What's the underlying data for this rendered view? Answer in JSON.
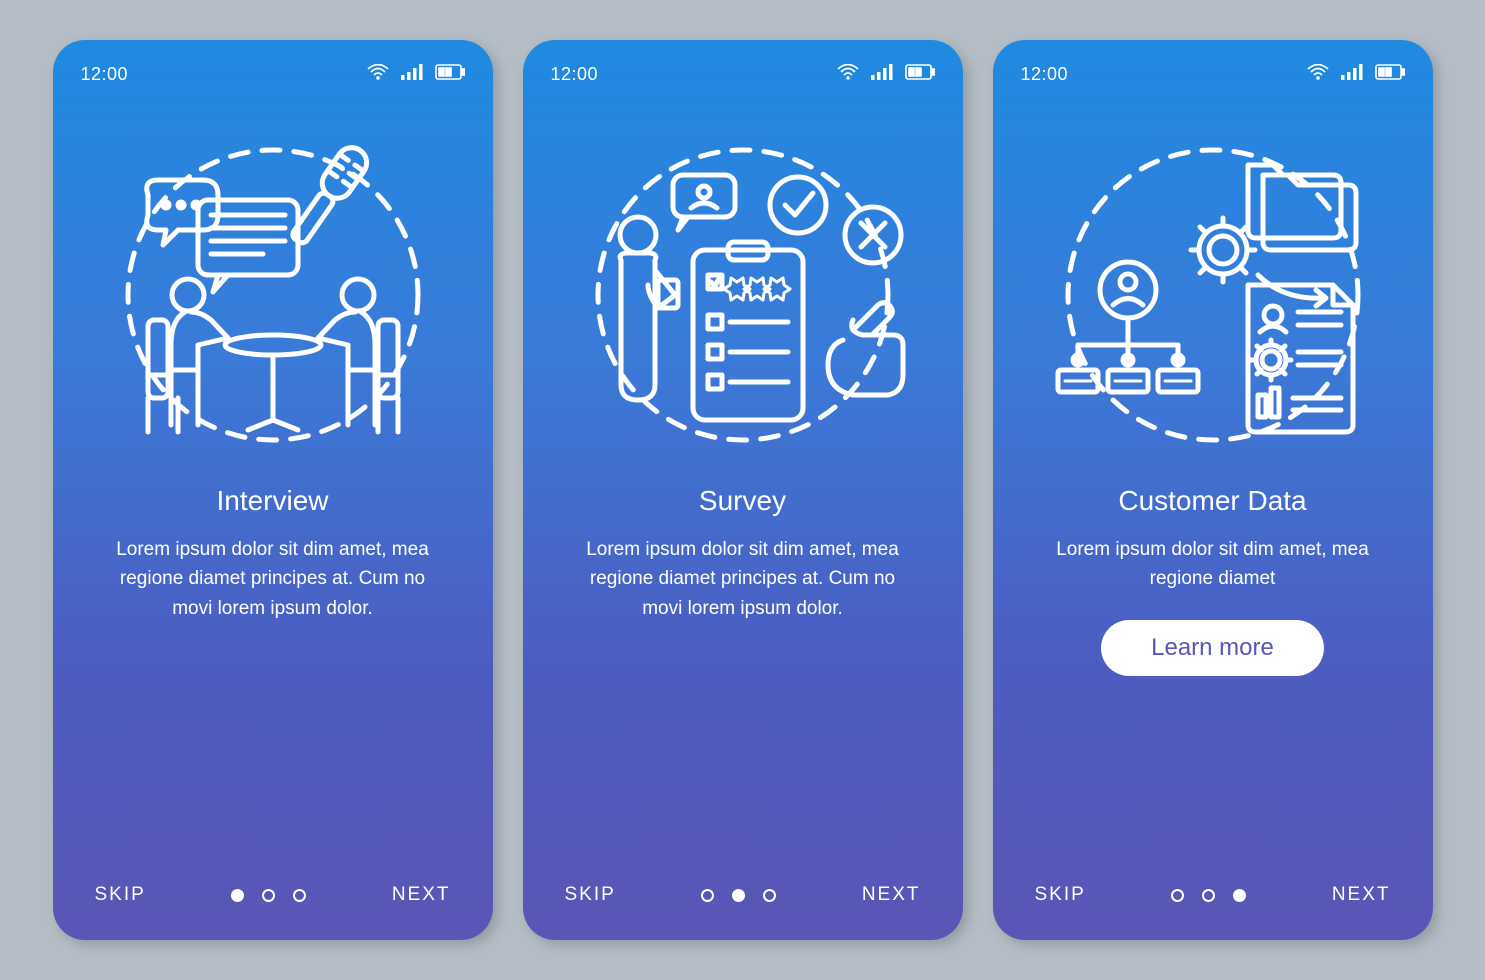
{
  "status": {
    "time": "12:00"
  },
  "screens": [
    {
      "title": "Interview",
      "body": "Lorem ipsum dolor sit dim amet, mea regione diamet principes at. Cum no movi lorem ipsum dolor.",
      "skip": "SKIP",
      "next": "NEXT",
      "activeDot": 0,
      "cta": null
    },
    {
      "title": "Survey",
      "body": "Lorem ipsum dolor sit dim amet, mea regione diamet principes at. Cum no movi lorem ipsum dolor.",
      "skip": "SKIP",
      "next": "NEXT",
      "activeDot": 1,
      "cta": null
    },
    {
      "title": "Customer Data",
      "body": "Lorem ipsum dolor sit dim amet, mea regione diamet",
      "skip": "SKIP",
      "next": "NEXT",
      "activeDot": 2,
      "cta": "Learn more"
    }
  ]
}
